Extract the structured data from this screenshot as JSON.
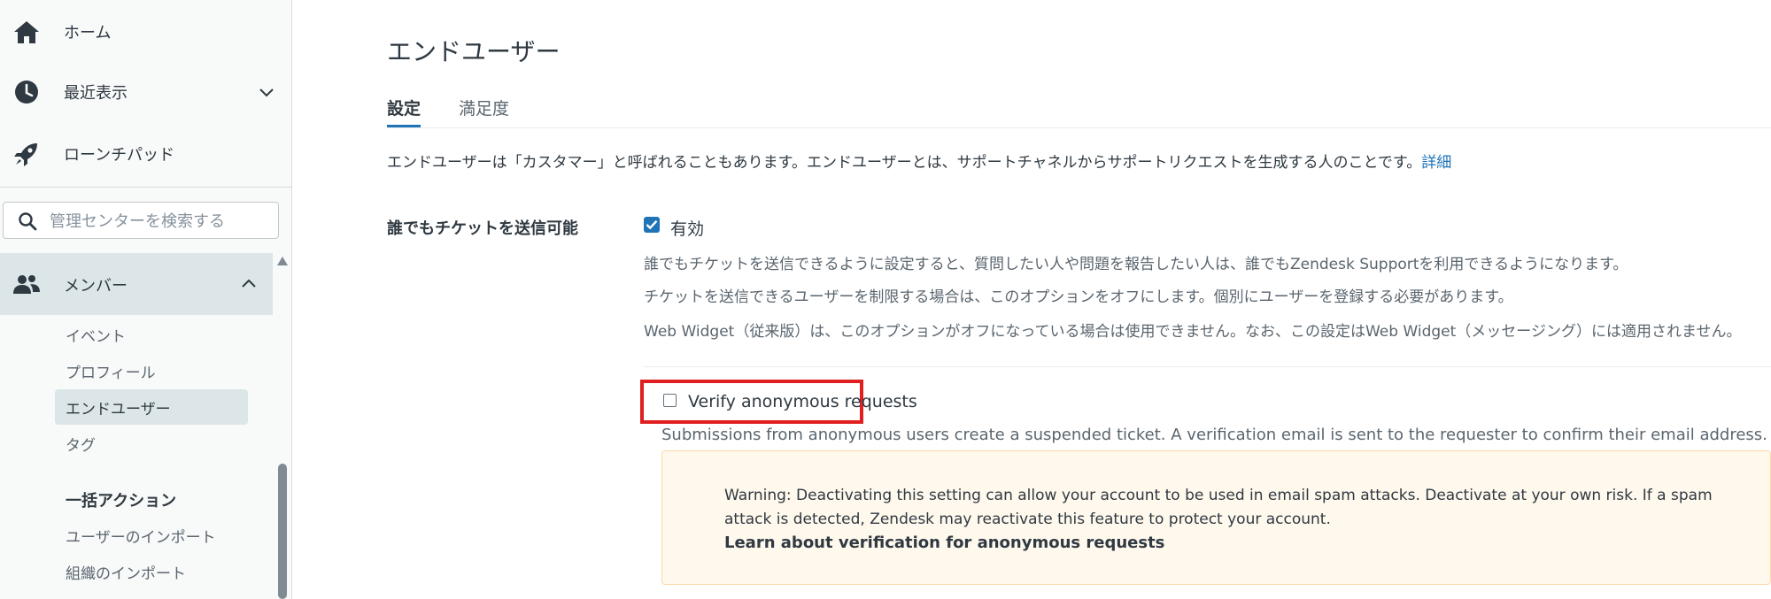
{
  "sidebar": {
    "home_label": "ホーム",
    "recent_label": "最近表示",
    "launchpad_label": "ローンチパッド",
    "search_placeholder": "管理センターを検索する",
    "members_label": "メンバー",
    "sub_items": [
      "イベント",
      "プロフィール",
      "エンドユーザー",
      "タグ"
    ],
    "bulk_actions_title": "一括アクション",
    "bulk_items": [
      "ユーザーのインポート",
      "組織のインポート"
    ],
    "active_item": "エンドユーザー"
  },
  "main": {
    "title": "エンドユーザー",
    "tabs": [
      {
        "label": "設定",
        "active": true
      },
      {
        "label": "満足度",
        "active": false
      }
    ],
    "intro_text": "エンドユーザーは「カスタマー」と呼ばれることもあります。エンドユーザーとは、サポートチャネルからサポートリクエストを生成する人のことです。",
    "intro_link": "詳細",
    "setting_label": "誰でもチケットを送信可能",
    "enabled_checkbox": {
      "label": "有効",
      "checked": true
    },
    "descriptions": [
      "誰でもチケットを送信できるように設定すると、質問したい人や問題を報告したい人は、誰でもZendesk Supportを利用できるようになります。",
      "チケットを送信できるユーザーを制限する場合は、このオプションをオフにします。個別にユーザーを登録する必要があります。",
      "Web Widget（従来版）は、このオプションがオフになっている場合は使用できません。なお、この設定はWeb Widget（メッセージング）には適用されません。"
    ],
    "verify_checkbox": {
      "label": "Verify anonymous requests",
      "checked": false
    },
    "verify_description": "Submissions from anonymous users create a suspended ticket. A verification email is sent to the requester to confirm their email address.",
    "warning": {
      "text": "Warning: Deactivating this setting can allow your account to be used in email spam attacks. Deactivate at your own risk. If a spam attack is detected, Zendesk may reactivate this feature to protect your account.",
      "link": "Learn about verification for anonymous requests"
    }
  },
  "colors": {
    "accent": "#1f73b7",
    "highlight_border": "#e02020",
    "warning_bg": "#fff8ed",
    "sidebar_active": "#dce6e8"
  }
}
